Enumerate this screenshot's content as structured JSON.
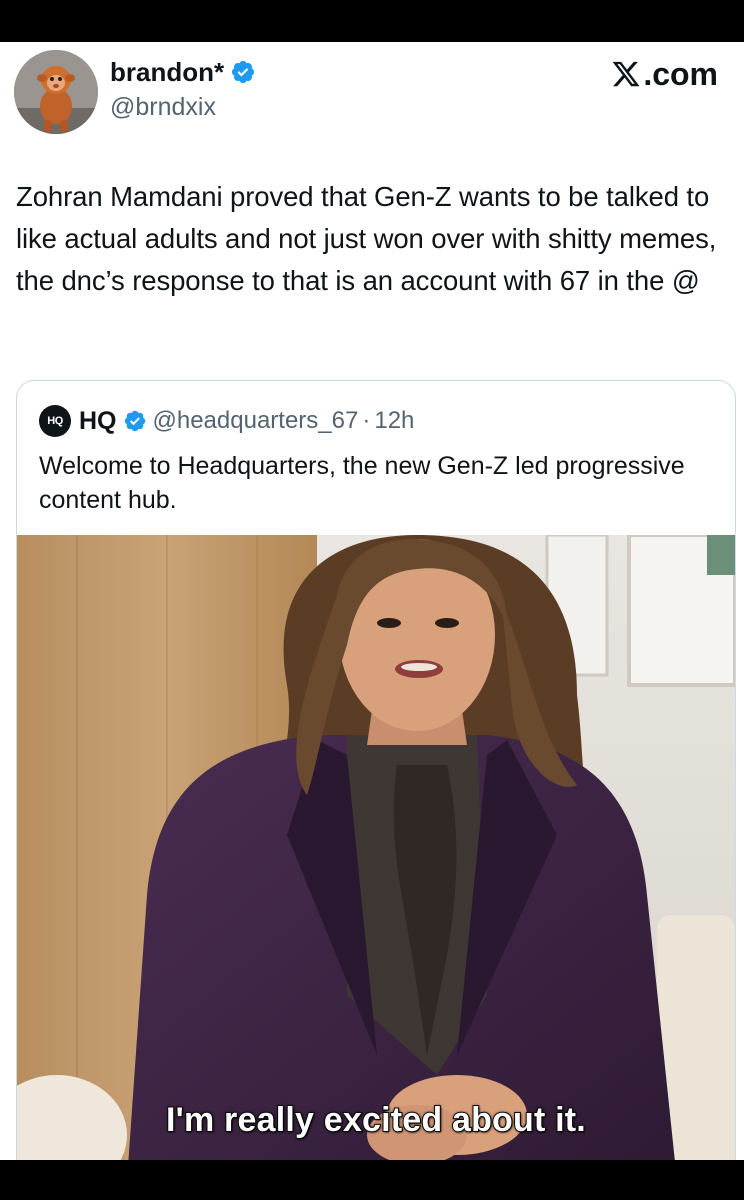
{
  "post": {
    "author": {
      "display_name": "brandon*",
      "handle": "@brndxix",
      "verified": true,
      "avatar_icon": "monkey-avatar"
    },
    "brand_label": ".com",
    "brand_icon": "x-logo-icon",
    "text": "Zohran Mamdani proved that Gen-Z wants to be talked to like actual adults and not just won over with shitty memes, the dnc’s response to that is an account with 67 in the @"
  },
  "quoted_post": {
    "logo_text": "HQ",
    "display_name": "HQ",
    "verified": true,
    "handle": "@headquarters_67",
    "separator": "·",
    "time": "12h",
    "text": "Welcome to Headquarters, the new Gen-Z led progressive content hub.",
    "media": {
      "caption": "I'm really excited about it."
    }
  },
  "colors": {
    "verified_blue": "#1d9bf0",
    "text_primary": "#0f1419",
    "text_secondary": "#536471",
    "border": "#cfd9de",
    "jacket": "#3a2340",
    "wood": "#c19a6b"
  }
}
